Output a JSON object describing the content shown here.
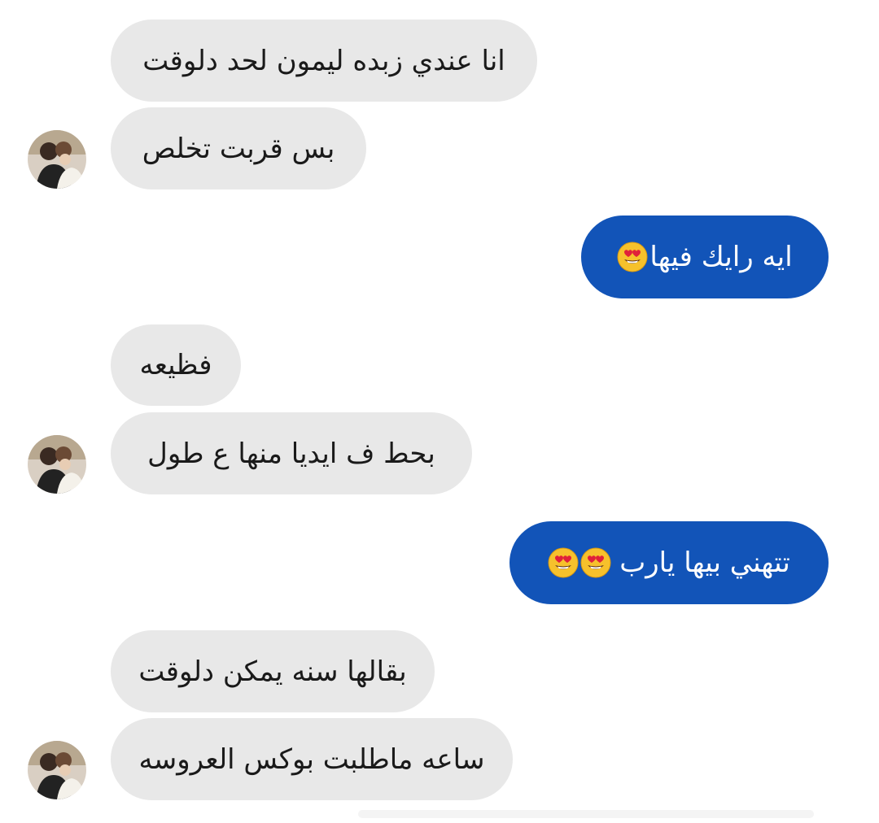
{
  "messages": [
    {
      "id": "m1",
      "direction": "incoming",
      "text": "انا عندي زبده ليمون لحد دلوقت"
    },
    {
      "id": "m2",
      "direction": "incoming",
      "text": "بس قربت تخلص"
    },
    {
      "id": "m3",
      "direction": "outgoing",
      "text": "ايه رايك فيها",
      "emoji": [
        "heart-eyes-emoji"
      ]
    },
    {
      "id": "m4",
      "direction": "incoming",
      "text": "فظيعه"
    },
    {
      "id": "m5",
      "direction": "incoming",
      "text": "بحط ف ايديا منها ع طول"
    },
    {
      "id": "m6",
      "direction": "outgoing",
      "text": "تتهني بيها يارب",
      "emoji": [
        "heart-eyes-emoji",
        "heart-eyes-emoji"
      ]
    },
    {
      "id": "m7",
      "direction": "incoming",
      "text": "بقالها سنه يمكن دلوقت"
    },
    {
      "id": "m8",
      "direction": "incoming",
      "text": "ساعه ماطلبت بوكس العروسه"
    }
  ],
  "colors": {
    "incoming_bubble": "#e8e8e8",
    "outgoing_bubble": "#1254b8",
    "outgoing_text": "#ffffff"
  },
  "icons": {
    "avatar": "contact-avatar-photo",
    "emoji": "heart-eyes-emoji"
  }
}
